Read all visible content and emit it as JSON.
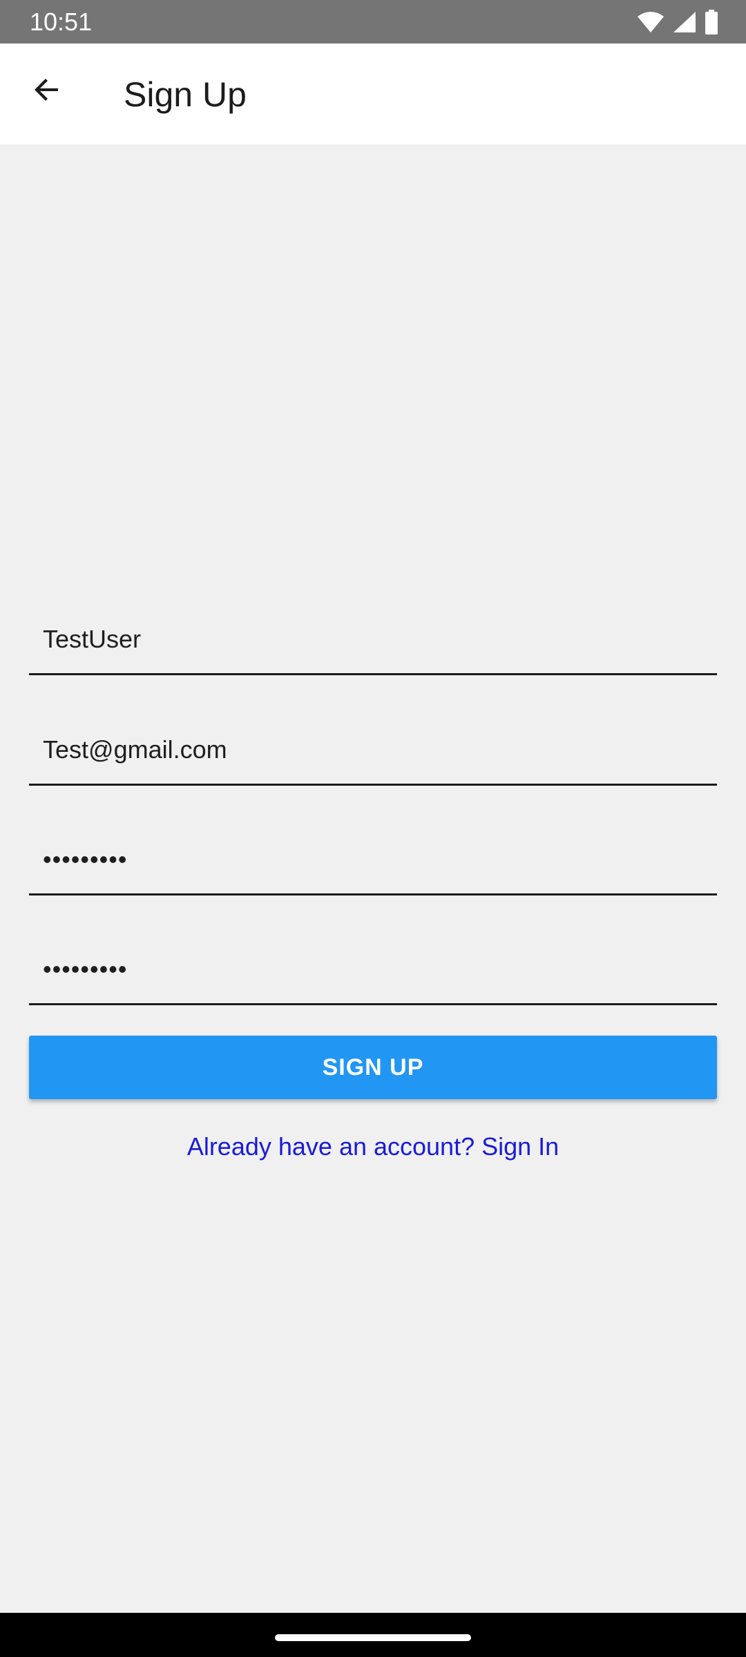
{
  "status_bar": {
    "time": "10:51",
    "icons": [
      "wifi-icon",
      "signal-icon",
      "battery-icon"
    ]
  },
  "app_bar": {
    "title": "Sign Up",
    "back_icon": "arrow-back-icon"
  },
  "form": {
    "username": {
      "value": "TestUser"
    },
    "email": {
      "value": "Test@gmail.com"
    },
    "password": {
      "value": "•••••••••"
    },
    "confirm_password": {
      "value": "•••••••••"
    },
    "submit_label": "SIGN UP",
    "signin_link": "Already have an account? Sign In"
  },
  "colors": {
    "status_bar_bg": "#757575",
    "app_bar_bg": "#ffffff",
    "background": "#f0f0f0",
    "primary_button": "#2196f3",
    "link": "#1a1adb",
    "nav_bar_bg": "#000000"
  }
}
